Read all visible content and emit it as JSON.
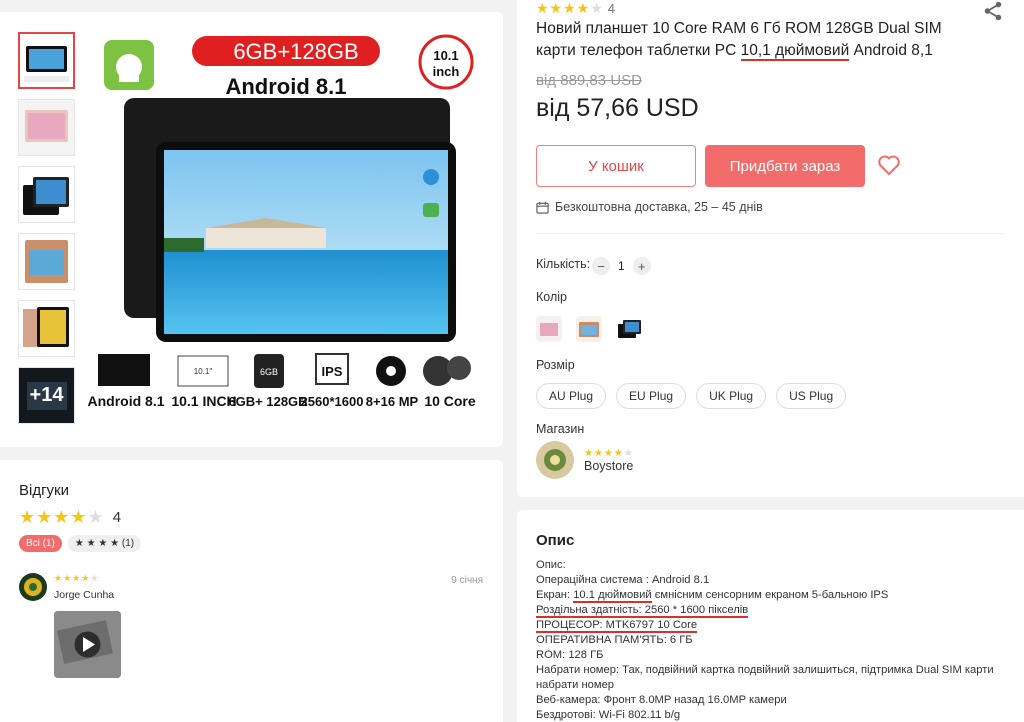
{
  "gallery": {
    "more_count": "+14",
    "main_image": {
      "badge_ram_rom": "6GB+128GB",
      "badge_os": "Android 8.1",
      "badge_size_top": "10.1",
      "badge_size_bottom": "inch",
      "features": [
        {
          "label": "Android 8.1"
        },
        {
          "label": "10.1 INCH"
        },
        {
          "label": "6GB+ 128GB"
        },
        {
          "label": "2560*1600"
        },
        {
          "label": "8+16 MP"
        },
        {
          "label": "10 Core"
        }
      ],
      "feature_icon_texts": {
        "size": "10.1\"",
        "ram": "6GB",
        "ips": "IPS"
      }
    }
  },
  "product": {
    "rating_value": "4",
    "title_part1": "Новий планшет 10 Core RAM 6 Гб ROM 128GB Dual SIM карти телефон таблетки PC ",
    "title_underlined": "10,1 дюймовий",
    "title_part2": " Android 8,1",
    "old_price": "від 889,83 USD",
    "price": "від 57,66 USD",
    "add_to_cart": "У кошик",
    "buy_now": "Придбати зараз",
    "delivery": "Безкоштовна доставка, 25 – 45 днів",
    "quantity_label": "Кількість:",
    "quantity_value": "1",
    "color_label": "Колір",
    "size_label": "Розмір",
    "plugs": [
      "AU Plug",
      "EU Plug",
      "UK Plug",
      "US Plug"
    ],
    "store_label": "Магазин",
    "store_name": "Boystore"
  },
  "reviews": {
    "title": "Відгуки",
    "average": "4",
    "chips": [
      "Всі (1)",
      "★ ★ ★ ★ (1)"
    ],
    "items": [
      {
        "name": "Jorge Cunha",
        "date": "9 січня"
      }
    ]
  },
  "description": {
    "title": "Опис",
    "lines": [
      "Опис:",
      "Операційна система : Android 8.1",
      "Екран: ",
      "10.1 дюймовий",
      " ємнісним сенсорним екраном 5-бальною IPS",
      "Роздільна здатність: ",
      "2560 * 1600 пікселів",
      "ПРОЦЕСОР: MTK6797 10 Core",
      "ОПЕРАТИВНА ПАМ'ЯТЬ: 6 ГБ",
      "ROM: 128 ГБ",
      "Набрати номер: Так, подвійний картка подвійний залишиться, підтримка Dual SIM карти набрати номер",
      "Веб-камера: Фронт 8.0MP назад 16.0MP камери",
      "Бездротові: Wi-Fi 802.11 b/g"
    ]
  },
  "colors": {
    "accent": "#f36c6c",
    "star": "#f5c518",
    "underline": "#d9302a"
  }
}
